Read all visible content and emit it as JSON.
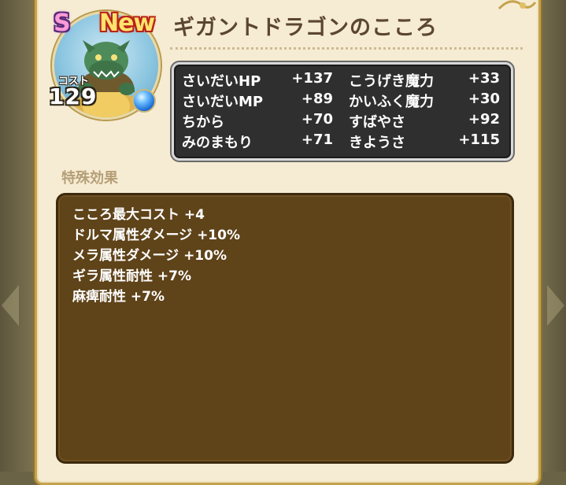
{
  "header": {
    "rank": "S",
    "new_badge": "New",
    "title": "ギガントドラゴンのこころ"
  },
  "cost": {
    "label": "コスト",
    "value": "129"
  },
  "stats": [
    {
      "name": "さいだいHP",
      "value": "+137"
    },
    {
      "name": "こうげき魔力",
      "value": "+33"
    },
    {
      "name": "さいだいMP",
      "value": "+89"
    },
    {
      "name": "かいふく魔力",
      "value": "+30"
    },
    {
      "name": "ちから",
      "value": "+70"
    },
    {
      "name": "すばやさ",
      "value": "+92"
    },
    {
      "name": "みのまもり",
      "value": "+71"
    },
    {
      "name": "きようさ",
      "value": "+115"
    }
  ],
  "special": {
    "label": "特殊効果",
    "effects": [
      "こころ最大コスト +4",
      "ドルマ属性ダメージ +10%",
      "メラ属性ダメージ +10%",
      "ギラ属性耐性 +7%",
      "麻痺耐性 +7%"
    ]
  },
  "colors": {
    "panel": "#f6ecd3",
    "title": "#5b4630",
    "stats_bg": "#2f2f2f",
    "effects_bg": "#5f4319",
    "section_label": "#b59f78"
  },
  "icons": [
    "left-arrow-icon",
    "right-arrow-icon",
    "blue-orb-icon",
    "monster-portrait",
    "corner-ornament-icon"
  ]
}
